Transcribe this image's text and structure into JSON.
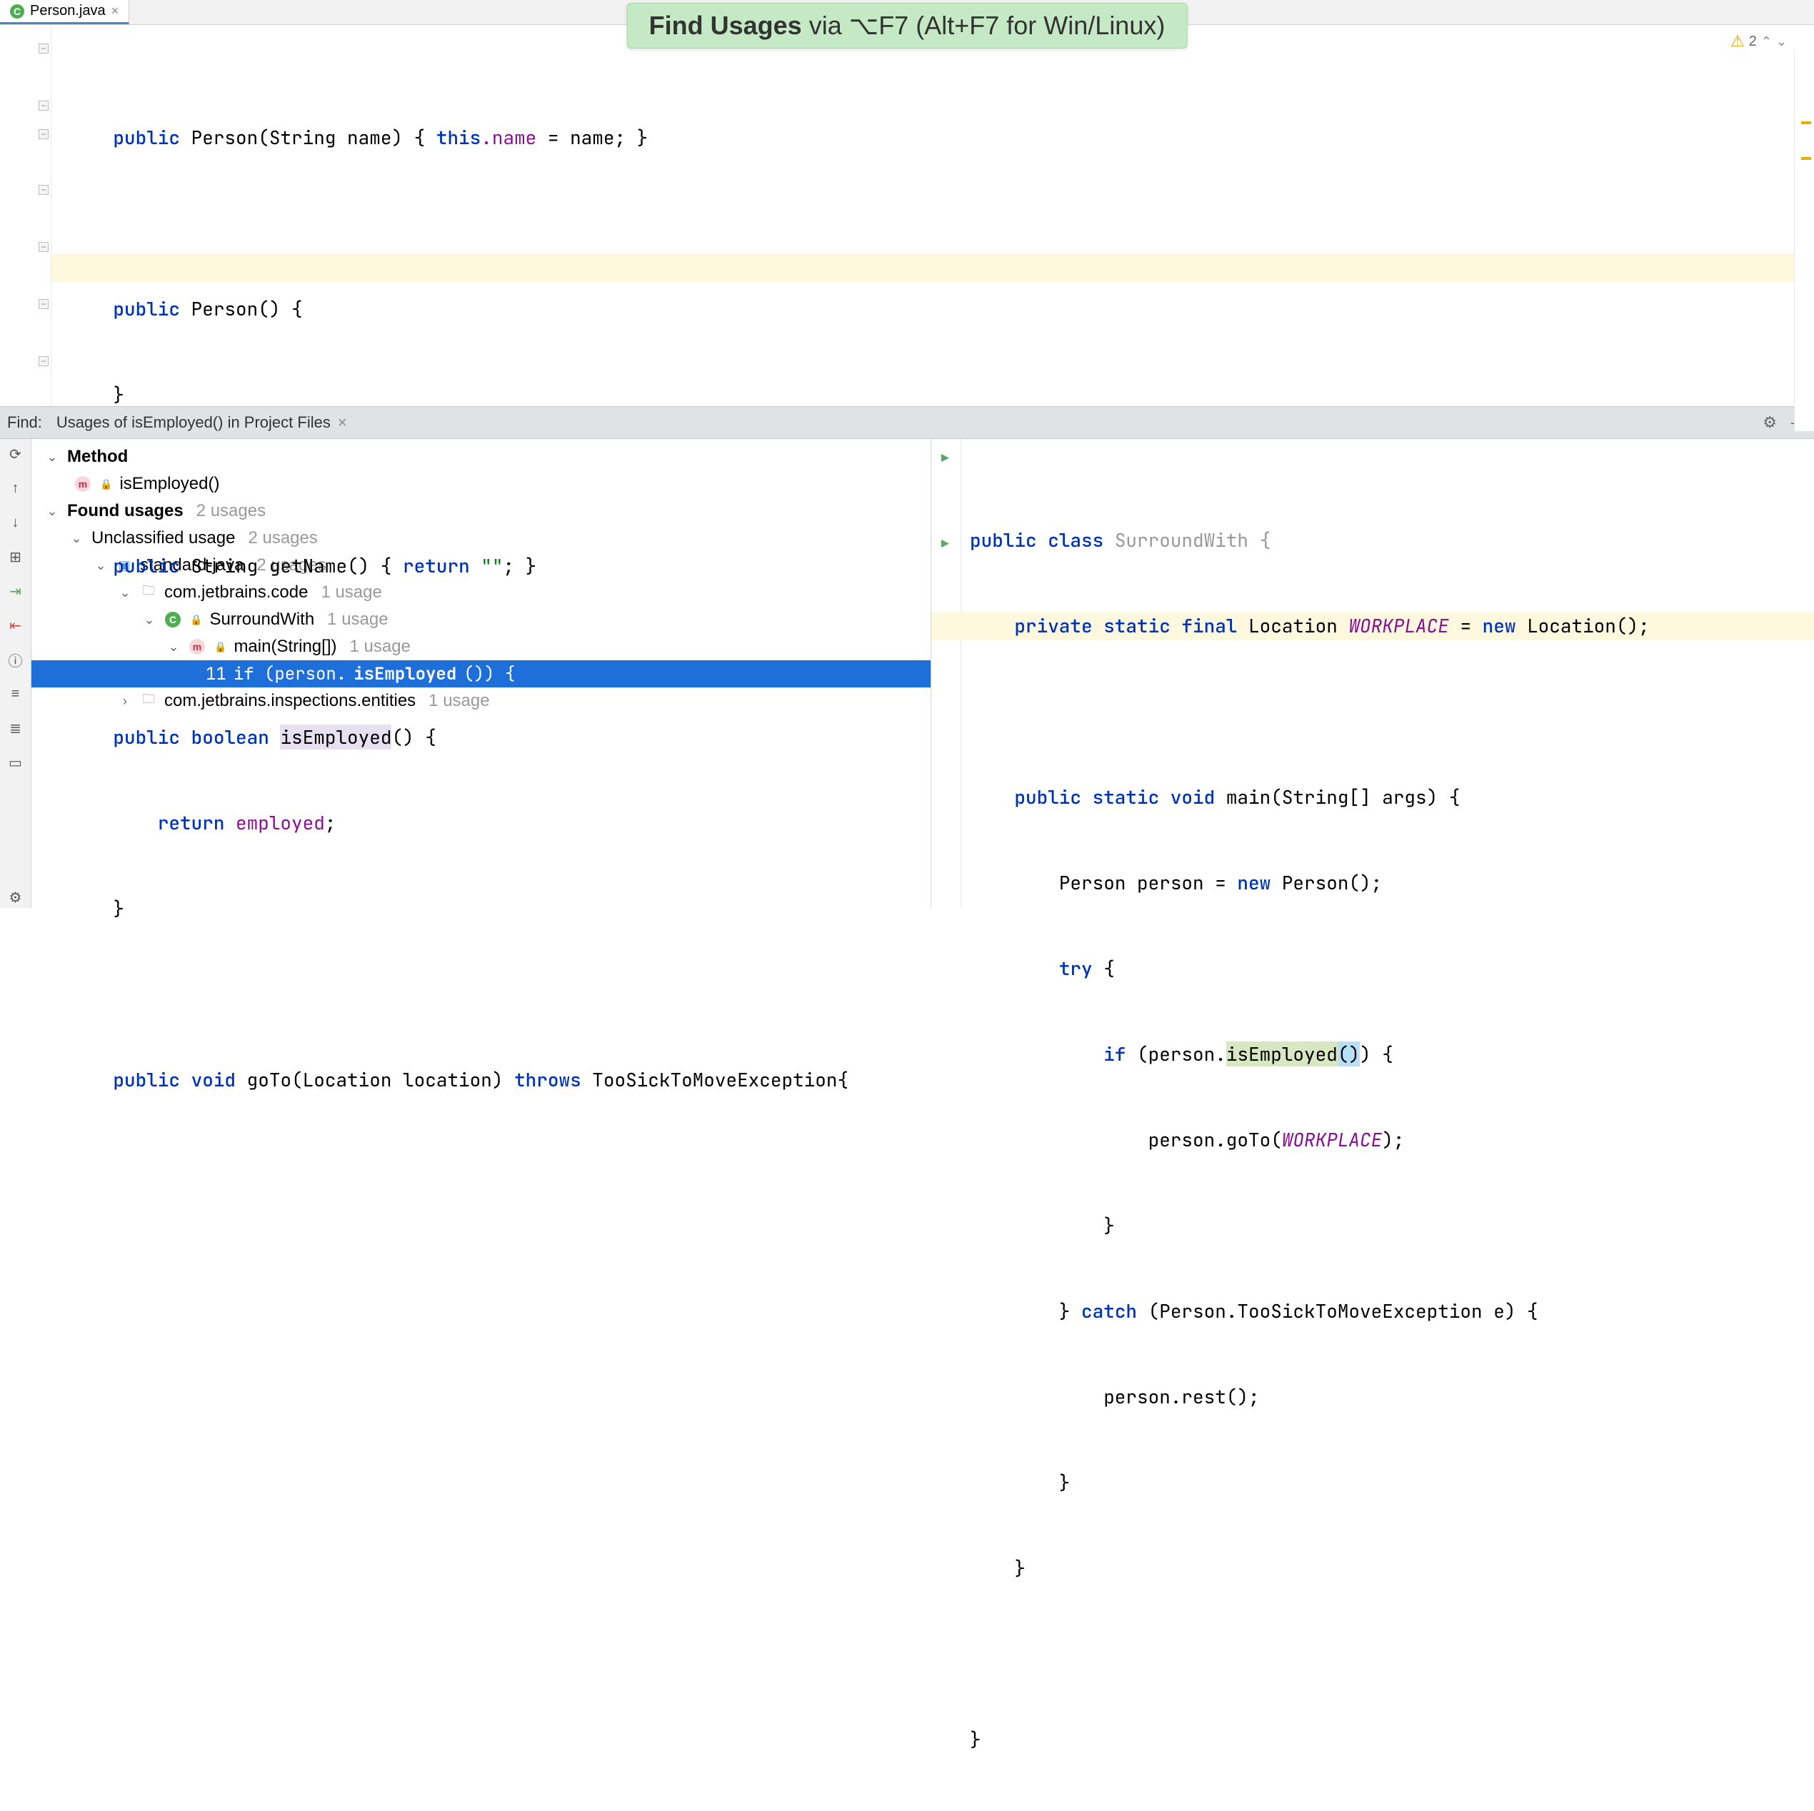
{
  "tab": {
    "filename": "Person.java",
    "iconLetter": "C"
  },
  "banner": {
    "bold": "Find Usages",
    "rest": " via ⌥F7 (Alt+F7 for Win/Linux)"
  },
  "warnings": {
    "count": "2"
  },
  "editor": {
    "l1": {
      "kw1": "public",
      "name": "Person",
      "args": "(String name)",
      "brace": " { ",
      "thiskw": "this",
      "dotname": ".name",
      "eq": " = name; }",
      "field": "name"
    },
    "l3": {
      "kw1": "public",
      "name": "Person",
      "rest": "() {"
    },
    "l4": {
      "brace": "}"
    },
    "l6": {
      "kw1": "public",
      "type": "String",
      "name": "getName",
      "rest": "() { ",
      "ret": "return",
      "str": "\"\"",
      "end": "; }"
    },
    "l8": {
      "kw1": "public",
      "kw2": "boolean",
      "name": "isEmployed",
      "rest": "() {"
    },
    "l9": {
      "ret": "return",
      "field": "employed",
      "semi": ";"
    },
    "l10": {
      "brace": "}"
    },
    "l12": {
      "kw1": "public",
      "kw2": "void",
      "name": "goTo",
      "args": "(Location location)",
      "kw3": "throws",
      "exc": "TooSickToMoveException{",
      "sp": " "
    }
  },
  "find": {
    "label": "Find:",
    "tabTitle": "Usages of isEmployed() in Project Files"
  },
  "tree": {
    "methodHeader": "Method",
    "methodName": "isEmployed()",
    "foundHeader": "Found usages",
    "foundCount": "2 usages",
    "unclassified": "Unclassified usage",
    "unclassifiedCount": "2 usages",
    "module": "standard-java",
    "moduleCount": "2 usages",
    "pkg1": "com.jetbrains.code",
    "pkg1Count": "1 usage",
    "cls": "SurroundWith",
    "clsCount": "1 usage",
    "method": "main(String[])",
    "methodCount": "1 usage",
    "usageLine": "11 ",
    "usagePre": "if (person.",
    "usageBold": "isEmployed",
    "usagePost": "()) {",
    "pkg2": "com.jetbrains.inspections.entities",
    "pkg2Count": "1 usage"
  },
  "preview": {
    "l1": {
      "kw1": "public class",
      "name": "SurroundWith",
      "rest": " {"
    },
    "l2": {
      "ind": "    ",
      "mods": "private static final",
      "type": " Location ",
      "field": "WORKPLACE",
      "eq": " = ",
      "kwnew": "new",
      "rest": " Location();"
    },
    "l4": {
      "ind": "    ",
      "mods": "public static void",
      "name": " main",
      "args": "(String[] args) {"
    },
    "l5": {
      "ind": "        ",
      "txt1": "Person person = ",
      "kwnew": "new",
      "txt2": " Person();"
    },
    "l6": {
      "ind": "        ",
      "kw": "try",
      "rest": " {"
    },
    "l7": {
      "ind": "            ",
      "kw": "if",
      "pre": " (person.",
      "call": "isEmployed",
      "paren": "()",
      "post": ") {"
    },
    "l8": {
      "ind": "                ",
      "pre": "person.goTo(",
      "field": "WORKPLACE",
      "post": ");"
    },
    "l9": {
      "ind": "            }",
      "rest": ""
    },
    "l10": {
      "ind": "        } ",
      "kw": "catch",
      "rest": " (Person.TooSickToMoveException e) {"
    },
    "l11": {
      "ind": "            person.rest();"
    },
    "l12": {
      "ind": "        }"
    },
    "l13": {
      "ind": "    }"
    },
    "l15": {
      "ind": "}"
    }
  }
}
